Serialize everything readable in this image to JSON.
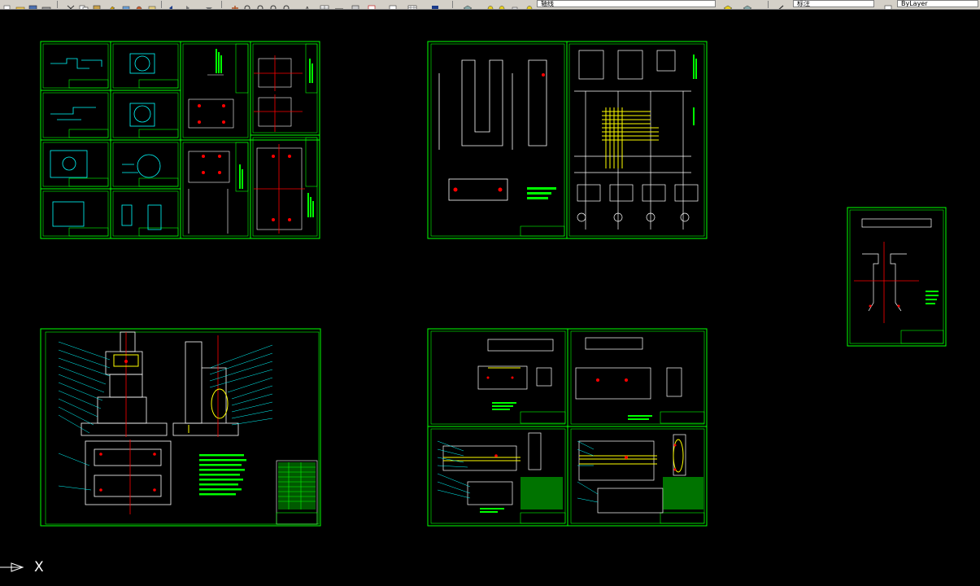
{
  "toolbar": {
    "layer_combo": "轴线",
    "linetype_combo": "标注",
    "style_combo": "ByLayer"
  },
  "ucs": {
    "axis_label": "X"
  },
  "colors": {
    "background": "#000000",
    "border": "#00ff00",
    "yellow": "#ffff00",
    "red": "#ff0000",
    "cyan": "#00ffff",
    "white": "#ffffff"
  }
}
